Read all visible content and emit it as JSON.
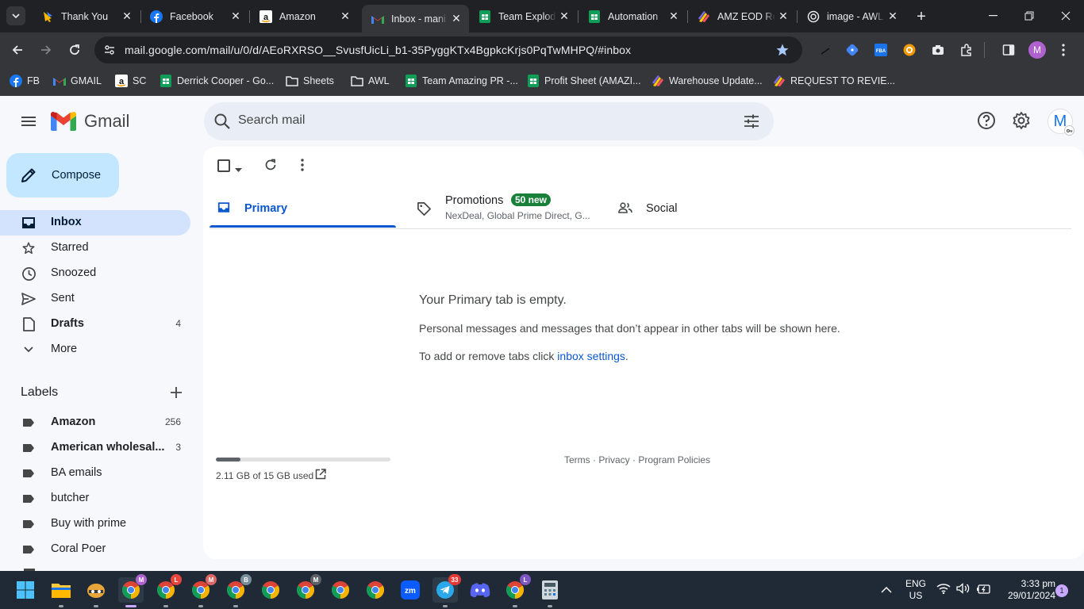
{
  "browser": {
    "tabs": [
      {
        "title": "Thank You",
        "icon": "forms-icon"
      },
      {
        "title": "Facebook",
        "icon": "facebook-icon"
      },
      {
        "title": "Amazon",
        "icon": "amazon-icon"
      },
      {
        "title": "Inbox - mani",
        "icon": "gmail-icon",
        "active": true
      },
      {
        "title": "Team Explod",
        "icon": "sheets-icon"
      },
      {
        "title": "Automation",
        "icon": "sheets-icon"
      },
      {
        "title": "AMZ EOD Re",
        "icon": "clickup-icon"
      },
      {
        "title": "image - AWL",
        "icon": "openai-icon"
      }
    ],
    "url": "mail.google.com/mail/u/0/d/AEoRXRSO__SvusfUicLi_b1-35PyggKTx4BgpkcKrjs0PqTwMHPQ/#inbox",
    "profile_letter": "M",
    "bookmarks": [
      {
        "label": "FB",
        "icon": "facebook-icon"
      },
      {
        "label": "GMAIL",
        "icon": "gmail-icon"
      },
      {
        "label": "SC",
        "icon": "amazon-icon"
      },
      {
        "label": "Derrick Cooper - Go...",
        "icon": "sheets-icon"
      },
      {
        "label": "Sheets",
        "icon": "folder-icon"
      },
      {
        "label": "AWL",
        "icon": "folder-icon"
      },
      {
        "label": "Team Amazing PR -...",
        "icon": "sheets-icon"
      },
      {
        "label": "Profit Sheet (AMAZI...",
        "icon": "sheets-icon"
      },
      {
        "label": "Warehouse Update...",
        "icon": "clickup-icon"
      },
      {
        "label": "REQUEST TO REVIE...",
        "icon": "clickup-icon"
      }
    ]
  },
  "gmail": {
    "logo_text": "Gmail",
    "search_placeholder": "Search mail",
    "avatar_letter": "M",
    "compose_label": "Compose",
    "nav": [
      {
        "label": "Inbox",
        "count": "",
        "icon": "inbox-icon",
        "active": true
      },
      {
        "label": "Starred",
        "count": "",
        "icon": "star-icon"
      },
      {
        "label": "Snoozed",
        "count": "",
        "icon": "clock-icon"
      },
      {
        "label": "Sent",
        "count": "",
        "icon": "send-icon"
      },
      {
        "label": "Drafts",
        "count": "4",
        "icon": "draft-icon",
        "bold": true
      },
      {
        "label": "More",
        "count": "",
        "icon": "chevron-down-icon"
      }
    ],
    "labels_heading": "Labels",
    "labels": [
      {
        "label": "Amazon",
        "count": "256",
        "bold": true
      },
      {
        "label": "American wholesal...",
        "count": "3",
        "bold": true
      },
      {
        "label": "BA emails",
        "count": ""
      },
      {
        "label": "butcher",
        "count": ""
      },
      {
        "label": "Buy with prime",
        "count": ""
      },
      {
        "label": "Coral Poer",
        "count": ""
      }
    ],
    "category_tabs": {
      "primary": "Primary",
      "promotions": "Promotions",
      "promotions_badge": "50 new",
      "promotions_snippet": "NexDeal, Global Prime Direct, G...",
      "social": "Social"
    },
    "empty": {
      "title": "Your Primary tab is empty.",
      "desc": "Personal messages and messages that don’t appear in other tabs will be shown here.",
      "settings_prefix": "To add or remove tabs click ",
      "settings_link": "inbox settings",
      "settings_suffix": "."
    },
    "storage": {
      "text": "2.11 GB of 15 GB used",
      "fraction": 0.14
    },
    "footer": {
      "terms": "Terms",
      "privacy": "Privacy",
      "policies": "Program Policies",
      "sep": " · "
    }
  },
  "taskbar": {
    "lang": "ENG",
    "region": "US",
    "time": "3:33 pm",
    "date": "29/01/2024",
    "notification_count": "1",
    "telegram_badge": "33",
    "profile_badges": [
      "M",
      "L",
      "M",
      "B",
      "M",
      "L"
    ]
  },
  "colors": {
    "gmail_blue": "#0b57d0",
    "compose_bg": "#c2e7ff",
    "active_nav": "#d3e3fd",
    "promo_badge": "#188038"
  }
}
